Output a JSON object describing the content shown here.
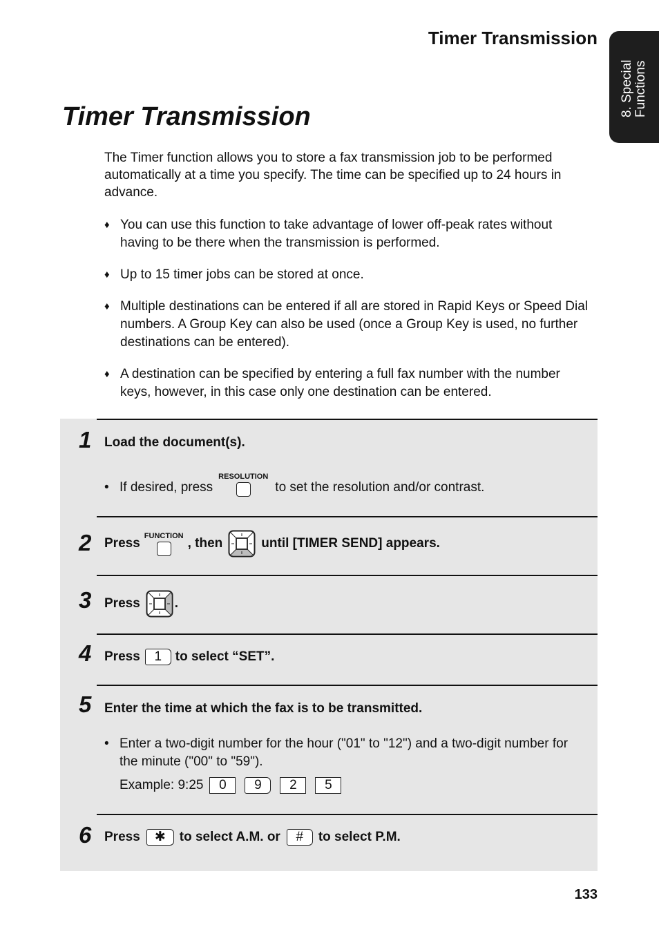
{
  "header": {
    "running_title": "Timer Transmission",
    "side_tab": "8. Special\nFunctions"
  },
  "page_title": "Timer Transmission",
  "intro": "The Timer function allows you to store a fax transmission job to be performed automatically at a time you specify. The time can be specified up to 24 hours in advance.",
  "bullet_icon": "♦",
  "bullets": [
    "You can use this function to take advantage of lower off-peak rates without having to be there when the transmission is performed.",
    "Up to 15 timer jobs can be stored at once.",
    "Multiple destinations can be entered if all are stored in Rapid Keys or Speed Dial numbers. A Group Key can also be used (once a Group Key is used, no further destinations can be entered).",
    "A destination can be specified by entering a full fax number with the number keys, however, in this case only one destination can be entered."
  ],
  "steps": [
    {
      "number": "1",
      "text": "Load the document(s).",
      "sub": {
        "dot": "•",
        "before": "If desired, press",
        "key_label": "RESOLUTION",
        "after": "to set the resolution and/or contrast."
      }
    },
    {
      "number": "2",
      "press": "Press",
      "key_label": "FUNCTION",
      "then": ", then",
      "after": "until [TIMER SEND] appears."
    },
    {
      "number": "3",
      "press": "Press",
      "after": "."
    },
    {
      "number": "4",
      "press": "Press",
      "key": "1",
      "after": "to select “SET”."
    },
    {
      "number": "5",
      "text": "Enter the time at which the fax is to be transmitted.",
      "sub": {
        "dot": "•",
        "text": "Enter a two-digit number for the hour (\"01\" to \"12\") and a two-digit number for the minute (\"00\" to \"59\").",
        "example_label": "Example: 9:25",
        "example_keys": [
          "0",
          "9",
          "2",
          "5"
        ]
      }
    },
    {
      "number": "6",
      "press": "Press",
      "key_am": "✱",
      "mid": "to select A.M. or",
      "key_pm": "#",
      "after": "to select P.M."
    }
  ],
  "page_number": "133"
}
